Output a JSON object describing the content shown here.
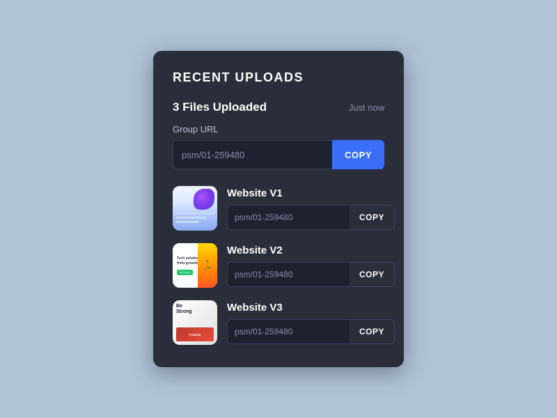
{
  "card": {
    "title": "RECENT UPLOADS",
    "files_count": "3 Files Uploaded",
    "timestamp": "Just now",
    "group_url_label": "Group URL",
    "group_url_value": "psm/01-259480",
    "copy_primary_label": "COPY",
    "files": [
      {
        "id": "v1",
        "name": "Website V1",
        "url": "psm/01-259480",
        "copy_label": "COPY"
      },
      {
        "id": "v2",
        "name": "Website V2",
        "url": "psm/01-259480",
        "copy_label": "COPY"
      },
      {
        "id": "v3",
        "name": "Website V3",
        "url": "psm/01-259480",
        "copy_label": "COPY"
      }
    ]
  }
}
